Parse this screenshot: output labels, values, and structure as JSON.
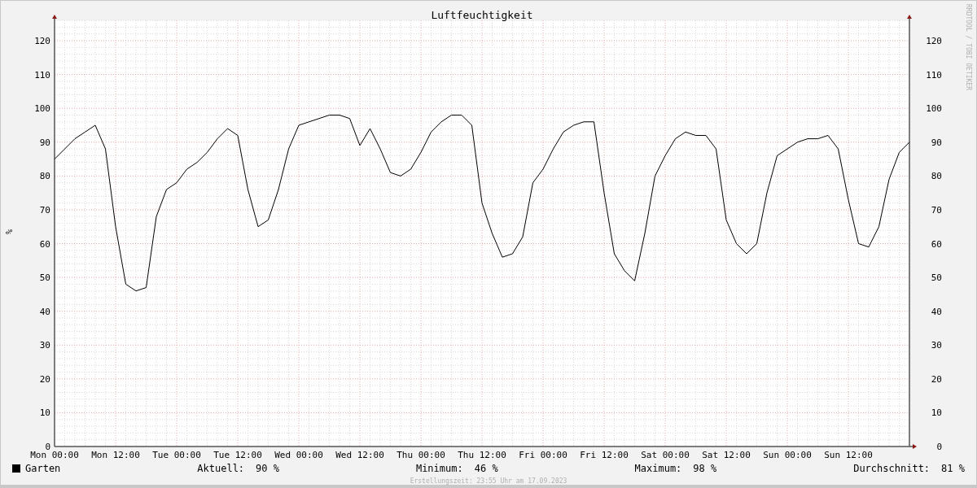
{
  "chart": {
    "right_axis_ticks": [
      "120",
      "110",
      "100",
      "90",
      "80",
      "70",
      "60",
      "50",
      "40",
      "30",
      "20",
      "10",
      "0"
    ],
    "chart_data": {
      "type": "line",
      "grid": true,
      "title": "Luftfeuchtigkeit",
      "ylabel": "%",
      "ylim": [
        0,
        126
      ],
      "categories": [
        "Mon 00:00",
        null,
        null,
        null,
        null,
        null,
        "Mon 12:00",
        null,
        null,
        null,
        null,
        null,
        "Tue 00:00",
        null,
        null,
        null,
        null,
        null,
        "Tue 12:00",
        null,
        null,
        null,
        null,
        null,
        "Wed 00:00",
        null,
        null,
        null,
        null,
        null,
        "Wed 12:00",
        null,
        null,
        null,
        null,
        null,
        "Thu 00:00",
        null,
        null,
        null,
        null,
        null,
        "Thu 12:00",
        null,
        null,
        null,
        null,
        null,
        "Fri 00:00",
        null,
        null,
        null,
        null,
        null,
        "Fri 12:00",
        null,
        null,
        null,
        null,
        null,
        "Sat 00:00",
        null,
        null,
        null,
        null,
        null,
        "Sat 12:00",
        null,
        null,
        null,
        null,
        null,
        "Sun 00:00",
        null,
        null,
        null,
        null,
        null,
        "Sun 12:00",
        null,
        null,
        null,
        null,
        null,
        null
      ],
      "yticks": [
        0,
        10,
        20,
        30,
        40,
        50,
        60,
        70,
        80,
        90,
        100,
        110,
        120
      ],
      "series": [
        {
          "name": "Garten",
          "color": "#000000",
          "values": [
            85,
            88,
            91,
            93,
            95,
            88,
            65,
            48,
            46,
            47,
            68,
            76,
            78,
            82,
            84,
            87,
            91,
            94,
            92,
            76,
            65,
            67,
            76,
            88,
            95,
            96,
            97,
            98,
            98,
            97,
            89,
            94,
            88,
            81,
            80,
            82,
            87,
            93,
            96,
            98,
            98,
            95,
            72,
            63,
            56,
            57,
            62,
            78,
            82,
            88,
            93,
            95,
            96,
            96,
            75,
            57,
            52,
            49,
            63,
            80,
            86,
            91,
            93,
            92,
            92,
            88,
            67,
            60,
            57,
            60,
            75,
            86,
            88,
            90,
            91,
            91,
            92,
            88,
            73,
            60,
            59,
            65,
            79,
            87,
            90
          ]
        }
      ]
    }
  },
  "credit": "RRDTOOL / TOBI OETIKER",
  "legend": {
    "stats": [
      {
        "label": "Aktuell:",
        "value": "90 %"
      },
      {
        "label": "Minimum:",
        "value": "46 %"
      },
      {
        "label": "Maximum:",
        "value": "98 %"
      },
      {
        "label": "Durchschnitt:",
        "value": "81 %"
      }
    ]
  },
  "footer": "Erstellungszeit: 23:55 Uhr am 17.09.2023"
}
